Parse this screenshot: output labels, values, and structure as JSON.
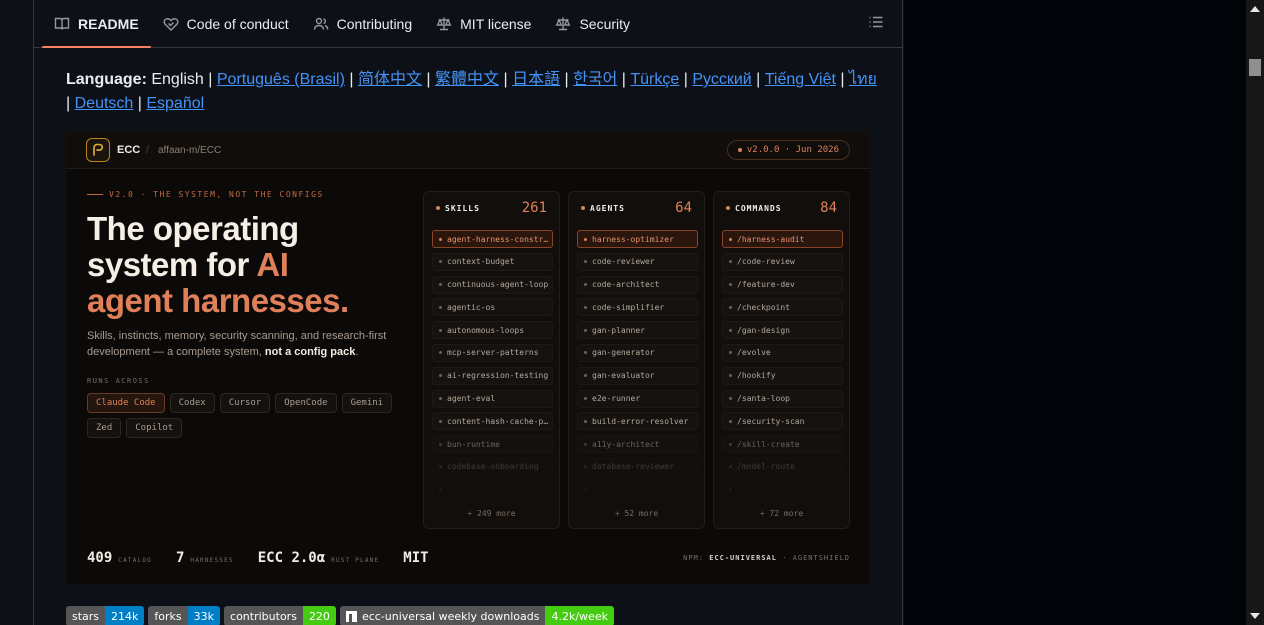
{
  "tabs": [
    {
      "label": "README",
      "icon": "book-icon",
      "active": true
    },
    {
      "label": "Code of conduct",
      "icon": "heart-handshake-icon",
      "active": false
    },
    {
      "label": "Contributing",
      "icon": "people-icon",
      "active": false
    },
    {
      "label": "MIT license",
      "icon": "law-icon",
      "active": false
    },
    {
      "label": "Security",
      "icon": "law-icon",
      "active": false
    }
  ],
  "outline_icon": "list-icon",
  "language": {
    "label": "Language:",
    "current": "English",
    "links": [
      "Português (Brasil)",
      "简体中文",
      "繁體中文",
      "日本語",
      "한국어",
      "Türkçe",
      "Русский",
      "Tiếng Việt",
      "ไทย",
      "Deutsch",
      "Español"
    ]
  },
  "hero": {
    "brand": "ECC",
    "separator": "/",
    "repo": "affaan-m/ECC",
    "version": "v2.0.0 · Jun 2026",
    "kicker": "V2.0 · THE SYSTEM, NOT THE CONFIGS",
    "headline_line1": "The operating",
    "headline_line2_a": "system for ",
    "headline_line2_b": "AI",
    "headline_line3": "agent harnesses.",
    "sub_text": "Skills, instincts, memory, security scanning, and research-first development — a complete system, ",
    "sub_strong": "not a config pack",
    "sub_end": ".",
    "runs_label": "RUNS ACROSS",
    "runs": [
      "Claude Code",
      "Codex",
      "Cursor",
      "OpenCode",
      "Gemini",
      "Zed",
      "Copilot"
    ],
    "columns": [
      {
        "title": "SKILLS",
        "count": "261",
        "items": [
          "agent-harness-constr…",
          "context-budget",
          "continuous-agent-loop",
          "agentic-os",
          "autonomous-loops",
          "mcp-server-patterns",
          "ai-regression-testing",
          "agent-eval",
          "content-hash-cache-p…",
          "bun-runtime",
          "codebase-onboarding"
        ],
        "more": "+ 249 more"
      },
      {
        "title": "AGENTS",
        "count": "64",
        "items": [
          "harness-optimizer",
          "code-reviewer",
          "code-architect",
          "code-simplifier",
          "gan-planner",
          "gan-generator",
          "gan-evaluator",
          "e2e-runner",
          "build-error-resolver",
          "a11y-architect",
          "database-reviewer"
        ],
        "more": "+ 52 more"
      },
      {
        "title": "COMMANDS",
        "count": "84",
        "items": [
          "/harness-audit",
          "/code-review",
          "/feature-dev",
          "/checkpoint",
          "/gan-design",
          "/evolve",
          "/hookify",
          "/santa-loop",
          "/security-scan",
          "/skill-create",
          "/model-route"
        ],
        "more": "+ 72 more"
      }
    ],
    "stats": [
      {
        "value": "409",
        "label": "CATALOG"
      },
      {
        "value": "7",
        "label": "HARNESSES"
      },
      {
        "value": "ECC 2.0α",
        "label": "RUST PLANE"
      },
      {
        "value": "MIT",
        "label": ""
      }
    ],
    "npm_label": "NPM: ",
    "npm_pkg": "ECC-UNIVERSAL",
    "npm_sep": " · ",
    "npm_extra": "AGENTSHIELD"
  },
  "badges": [
    {
      "key": "stars",
      "value": "214k",
      "color": "#007ec6"
    },
    {
      "key": "forks",
      "value": "33k",
      "color": "#007ec6"
    },
    {
      "key": "contributors",
      "value": "220",
      "color": "#4c1"
    },
    {
      "key": "ecc-universal weekly downloads",
      "value": "4.2k/week",
      "color": "#4c1",
      "icon": "npm-icon"
    }
  ]
}
